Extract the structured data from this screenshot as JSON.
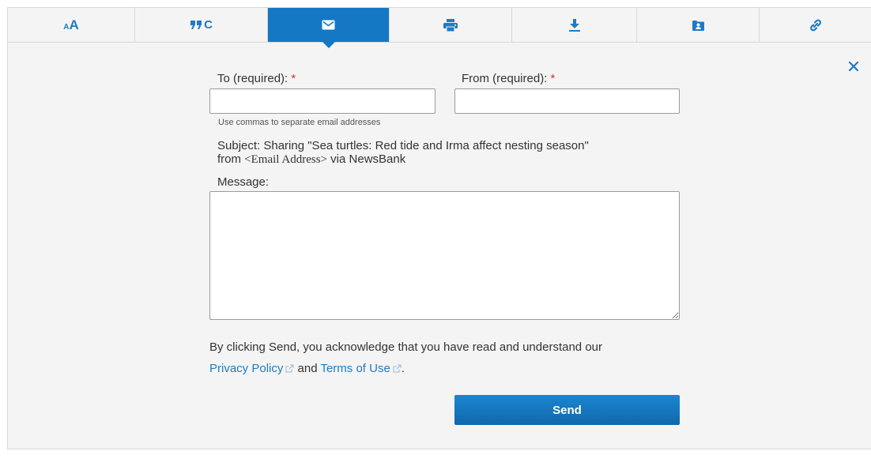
{
  "toolbar": {
    "tabs": [
      {
        "icon": "font-size-icon",
        "label": "",
        "active": false
      },
      {
        "icon": "cite-icon",
        "label": "",
        "active": false
      },
      {
        "icon": "email-icon",
        "label": "",
        "active": true
      },
      {
        "icon": "print-icon",
        "label": "",
        "active": false
      },
      {
        "icon": "download-icon",
        "label": "",
        "active": false
      },
      {
        "icon": "save-to-folder-icon",
        "label": "",
        "active": false
      },
      {
        "icon": "link-icon",
        "label": "",
        "active": false
      }
    ],
    "cite_text": "C"
  },
  "form": {
    "to_label": "To (required):",
    "from_label": "From (required):",
    "required_marker": "*",
    "to_value": "",
    "from_value": "",
    "hint": "Use commas to separate email addresses",
    "subject_prefix": "Subject: Sharing \"Sea turtles: Red tide and Irma affect nesting season\"",
    "subject_from": "from",
    "subject_address": "<Email Address>",
    "subject_suffix": "via NewsBank",
    "message_label": "Message:",
    "message_value": "",
    "ack_text": "By clicking Send, you acknowledge that you have read and understand our",
    "privacy_link": "Privacy Policy",
    "and_text": "and",
    "terms_link": "Terms of Use",
    "period": ".",
    "send_label": "Send"
  },
  "colors": {
    "accent": "#1478c4",
    "link": "#1f7bc1",
    "required": "#d9302c",
    "panel_bg": "#f4f4f4"
  }
}
